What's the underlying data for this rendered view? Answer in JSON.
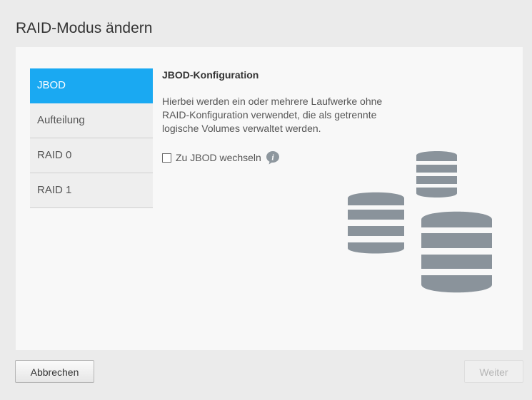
{
  "dialog": {
    "title": "RAID-Modus ändern"
  },
  "modes": {
    "items": [
      {
        "label": "JBOD",
        "active": true
      },
      {
        "label": "Aufteilung",
        "active": false
      },
      {
        "label": "RAID 0",
        "active": false
      },
      {
        "label": "RAID 1",
        "active": false
      }
    ]
  },
  "content": {
    "title": "JBOD-Konfiguration",
    "description": "Hierbei werden ein oder mehrere Laufwerke ohne RAID-Konfiguration verwendet, die als getrennte logische Volumes verwaltet werden.",
    "switch_label": "Zu JBOD wechseln",
    "switch_checked": false,
    "info_icon": "info-icon"
  },
  "footer": {
    "cancel_label": "Abbrechen",
    "next_label": "Weiter",
    "next_enabled": false
  },
  "colors": {
    "accent": "#1aa9f2",
    "disk_stack": "#8a939b",
    "info_icon": "#8e979e"
  }
}
